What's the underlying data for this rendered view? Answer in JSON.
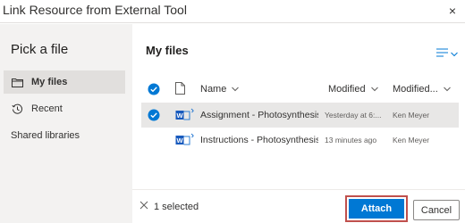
{
  "dialog": {
    "title": "Link Resource from External Tool",
    "close_symbol": "×"
  },
  "sidebar": {
    "heading": "Pick a file",
    "items": [
      {
        "label": "My files",
        "icon": "folder-icon",
        "active": true
      },
      {
        "label": "Recent",
        "icon": "history-icon",
        "active": false
      },
      {
        "label": "Shared libraries",
        "icon": null,
        "active": false
      }
    ]
  },
  "main": {
    "heading": "My files",
    "view_icon": "list-view-icon",
    "columns": {
      "name": "Name",
      "modified": "Modified",
      "modified_by": "Modified..."
    },
    "files": [
      {
        "name": "Assignment - Photosynthesis....",
        "modified": "Yesterday at 6:...",
        "modified_by": "Ken Meyer",
        "selected": true,
        "icon": "word-doc-icon"
      },
      {
        "name": "Instructions - Photosynthesis....",
        "modified": "13 minutes ago",
        "modified_by": "Ken Meyer",
        "selected": false,
        "icon": "word-doc-icon"
      }
    ]
  },
  "footer": {
    "selection_count": "1 selected",
    "attach_label": "Attach",
    "cancel_label": "Cancel"
  },
  "colors": {
    "accent": "#0078d4",
    "highlight_border": "#c0504d",
    "sidebar_bg": "#f3f2f1"
  }
}
